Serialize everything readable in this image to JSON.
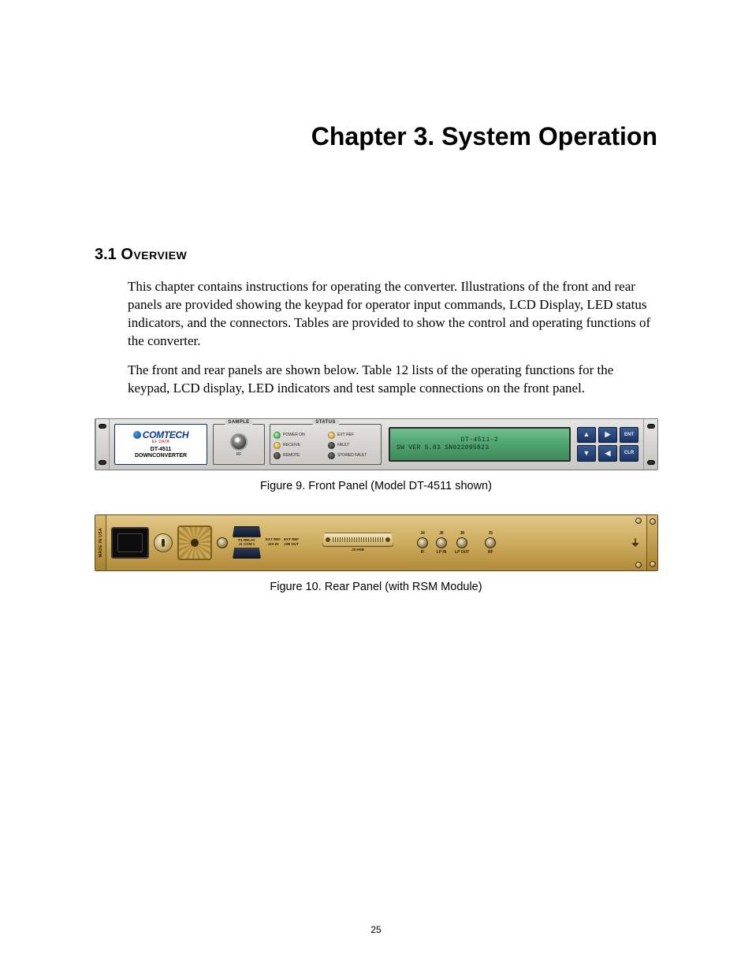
{
  "chapter": {
    "title": "Chapter 3.  System Operation"
  },
  "section": {
    "number": "3.1",
    "label": "Overview"
  },
  "paragraphs": {
    "p1": "This chapter contains instructions for operating the converter. Illustrations of the front and rear panels are provided showing the keypad for operator input commands, LCD Display, LED status indicators, and the connectors. Tables are provided to show the control and operating functions of the converter.",
    "p2": "The front and rear panels are shown below. Table 12 lists of the operating functions for the keypad, LCD display, LED indicators and test sample connections on the front panel."
  },
  "front_panel": {
    "brand": {
      "name": "COMTECH",
      "tagline": "EF DATA",
      "model_line1": "DT-4511",
      "model_line2": "DOWNCONVERTER"
    },
    "sample": {
      "legend": "SAMPLE",
      "label": "RF"
    },
    "status": {
      "legend": "STATUS",
      "col1": {
        "a": "POWER ON",
        "b": "RECEIVE",
        "c": "REMOTE"
      },
      "col2": {
        "a": "EXT REF",
        "b": "FAULT",
        "c": "STORED FAULT"
      }
    },
    "lcd": {
      "line1": "DT-4511-2",
      "line2": "SW VER 5.83  SN022095823"
    },
    "keypad": {
      "up": "▲",
      "right": "▶",
      "ent": "ENT",
      "down": "▼",
      "left": "◀",
      "clr": "CLR"
    }
  },
  "rear_panel": {
    "made": "MADE IN USA",
    "p1": {
      "top": "P1 RELAY",
      "bot": "J1 COM 1"
    },
    "extref": {
      "a_top": "EXT REF",
      "a_bot": "J2A IN",
      "b_top": "EXT REF",
      "b_bot": "J2B OUT"
    },
    "hsb": "J3 HSB",
    "j4": "J4",
    "j6": "J6",
    "j8": "J8",
    "j5": "J5",
    "if": "IF",
    "lpin": "LP IN",
    "lpout": "LP OUT",
    "rf": "RF"
  },
  "captions": {
    "fig9": "Figure 9.  Front Panel (Model DT-4511 shown)",
    "fig10": "Figure 10.  Rear Panel (with RSM Module)"
  },
  "page_number": "25"
}
